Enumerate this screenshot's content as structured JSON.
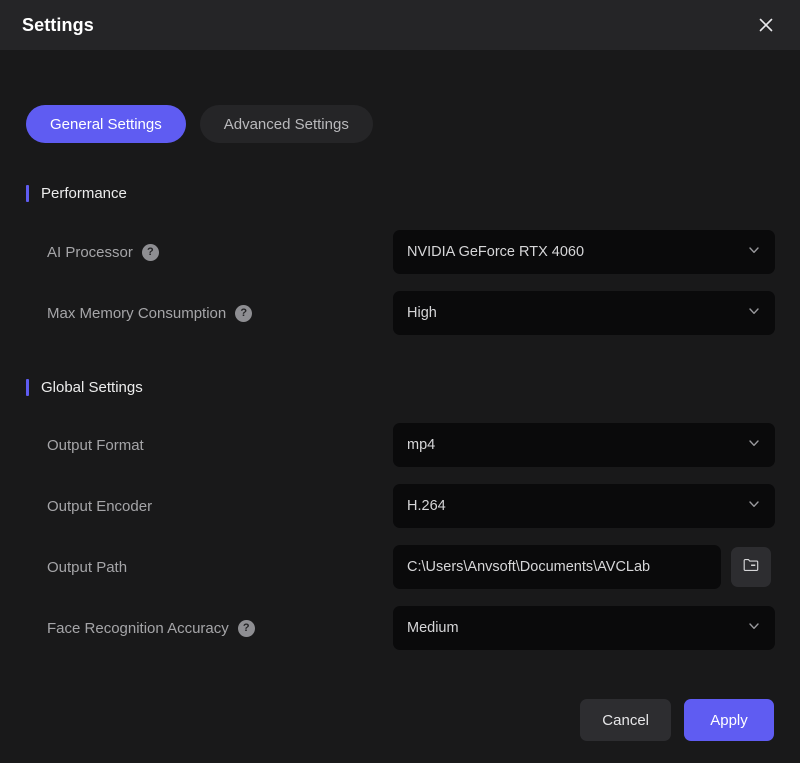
{
  "window": {
    "title": "Settings",
    "close_icon": "close-icon"
  },
  "theme": {
    "accent": "#5f5cf2",
    "titlebar_bg": "#252527",
    "body_bg": "#19191a",
    "field_bg": "#0a0a0b",
    "button_bg": "#2d2d30",
    "label_color": "#a5a5a8"
  },
  "tabs": [
    {
      "label": "General Settings",
      "active": true
    },
    {
      "label": "Advanced Settings",
      "active": false
    }
  ],
  "sections": [
    {
      "title": "Performance",
      "rows": [
        {
          "label": "AI Processor",
          "help": true,
          "help_glyph": "?",
          "control": "dropdown",
          "value": "NVIDIA GeForce RTX 4060"
        },
        {
          "label": "Max Memory Consumption",
          "help": true,
          "help_glyph": "?",
          "control": "dropdown",
          "value": "High"
        }
      ]
    },
    {
      "title": "Global Settings",
      "rows": [
        {
          "label": "Output Format",
          "help": false,
          "control": "dropdown",
          "value": "mp4"
        },
        {
          "label": "Output Encoder",
          "help": false,
          "control": "dropdown",
          "value": "H.264"
        },
        {
          "label": "Output Path",
          "help": false,
          "control": "path",
          "value": "C:\\Users\\Anvsoft\\Documents\\AVCLab",
          "browse_icon": "folder-icon"
        },
        {
          "label": "Face Recognition Accuracy",
          "help": true,
          "help_glyph": "?",
          "control": "dropdown",
          "value": "Medium"
        }
      ]
    }
  ],
  "footer": {
    "cancel_label": "Cancel",
    "apply_label": "Apply"
  }
}
